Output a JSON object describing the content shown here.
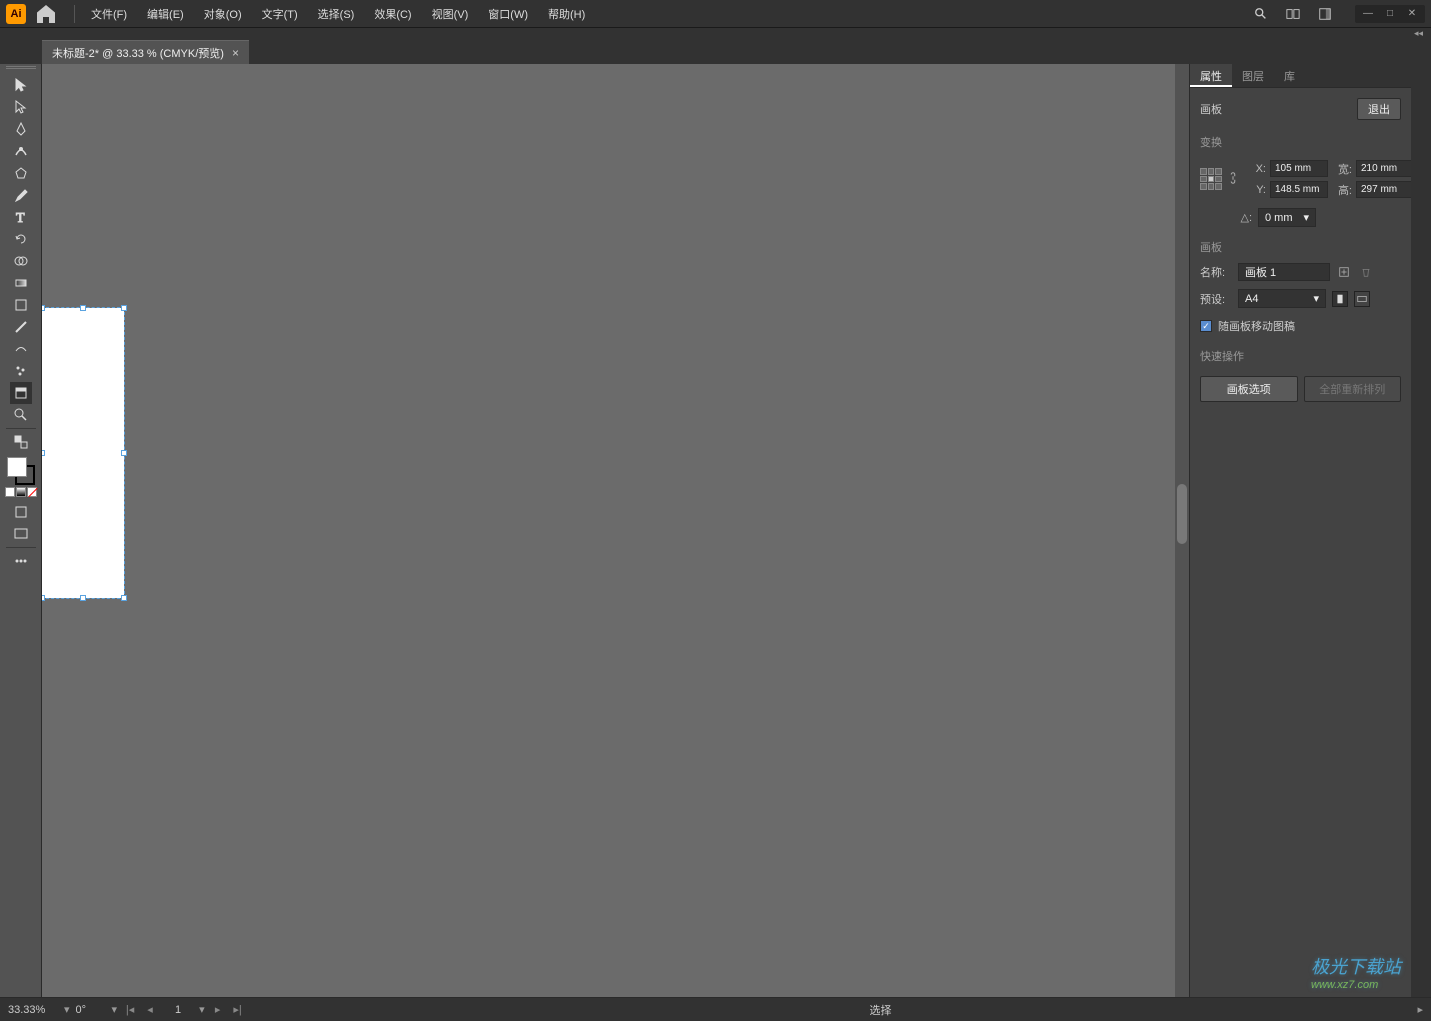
{
  "menu": {
    "file": "文件(F)",
    "edit": "编辑(E)",
    "object": "对象(O)",
    "type": "文字(T)",
    "select": "选择(S)",
    "effect": "效果(C)",
    "view": "视图(V)",
    "window": "窗口(W)",
    "help": "帮助(H)"
  },
  "tab": {
    "title": "未标题-2* @ 33.33 % (CMYK/预览)"
  },
  "panel": {
    "tabs": {
      "properties": "属性",
      "layers": "图层",
      "libraries": "库"
    },
    "artboard_header": "画板",
    "exit": "退出",
    "transform": "变换",
    "x_label": "X:",
    "x_value": "105 mm",
    "y_label": "Y:",
    "y_value": "148.5 mm",
    "w_label": "宽:",
    "w_value": "210 mm",
    "h_label": "高:",
    "h_value": "297 mm",
    "angle_label": "△:",
    "angle_value": "0 mm",
    "artboard_section": "画板",
    "name_label": "名称:",
    "name_value": "画板 1",
    "preset_label": "预设:",
    "preset_value": "A4",
    "move_artwork": "随画板移动图稿",
    "quick_actions": "快速操作",
    "artboard_options": "画板选项",
    "rearrange_all": "全部重新排列"
  },
  "status": {
    "zoom": "33.33%",
    "rotation": "0°",
    "artboard_num": "1",
    "mode": "选择"
  },
  "watermark": {
    "main": "极光下载站",
    "sub": "www.xz7.com"
  }
}
